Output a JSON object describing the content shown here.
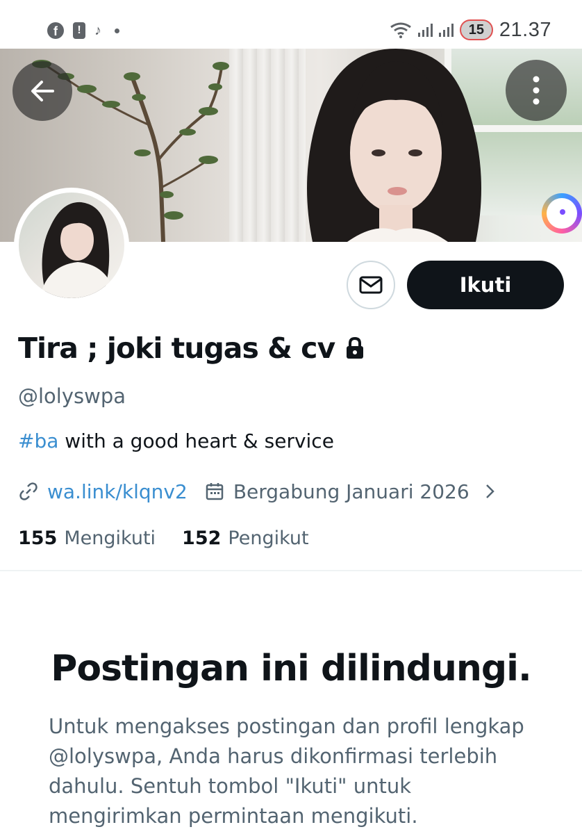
{
  "status_bar": {
    "time": "21.37",
    "notification_count": "15",
    "left_icons": [
      "facebook-icon",
      "battery-alert-icon",
      "tiktok-icon",
      "dot-icon"
    ],
    "right_icons": [
      "wifi-icon",
      "signal-icon",
      "signal-icon"
    ]
  },
  "profile": {
    "display_name": "Tira ; joki tugas & cv",
    "protected": true,
    "handle": "@lolyswpa",
    "bio_hashtag": "#ba",
    "bio_text": " with a good heart & service",
    "link": "wa.link/klqnv2",
    "joined": "Bergabung Januari 2026",
    "following_count": "155",
    "following_label": "Mengikuti",
    "followers_count": "152",
    "followers_label": "Pengikut"
  },
  "actions": {
    "follow_label": "Ikuti",
    "message_icon": "mail-icon",
    "back_icon": "arrow-left-icon",
    "more_icon": "more-vertical-icon"
  },
  "protected_notice": {
    "title": "Postingan ini dilindungi.",
    "body": "Untuk mengakses postingan dan profil lengkap @lolyswpa, Anda harus dikonfirmasi terlebih dahulu. Sentuh tombol \"Ikuti\" untuk mengirimkan permintaan mengikuti."
  },
  "colors": {
    "link_blue": "#3a8ed0",
    "text_primary": "#0f1419",
    "text_secondary": "#536471",
    "follow_button_bg": "#0f1419"
  }
}
